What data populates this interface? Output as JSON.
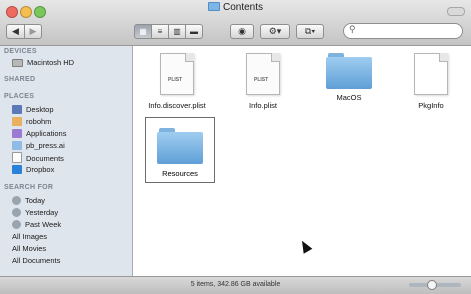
{
  "window": {
    "title": "Contents"
  },
  "toolbar": {
    "back_icon": "chevron-left-icon",
    "forward_icon": "chevron-right-icon",
    "views": [
      "icon-view",
      "list-view",
      "column-view",
      "coverflow-view"
    ],
    "quicklook_icon": "eye-icon",
    "action_icon": "gear-icon",
    "dropbox_icon": "dropbox-icon",
    "search_placeholder": ""
  },
  "sidebar": {
    "devices_header": "DEVICES",
    "devices": [
      {
        "label": "Macintosh HD",
        "icon": "hard-drive-icon"
      }
    ],
    "shared_header": "SHARED",
    "places_header": "PLACES",
    "places": [
      {
        "label": "Desktop",
        "icon": "desktop-icon"
      },
      {
        "label": "robohm",
        "icon": "home-icon"
      },
      {
        "label": "Applications",
        "icon": "applications-icon"
      },
      {
        "label": "pb_press.ai",
        "icon": "folder-icon"
      },
      {
        "label": "Documents",
        "icon": "documents-icon"
      },
      {
        "label": "Dropbox",
        "icon": "dropbox-icon"
      }
    ],
    "search_header": "SEARCH FOR",
    "search": [
      {
        "label": "Today",
        "icon": "clock-icon"
      },
      {
        "label": "Yesterday",
        "icon": "clock-icon"
      },
      {
        "label": "Past Week",
        "icon": "clock-icon"
      },
      {
        "label": "All Images",
        "icon": "smart-folder-icon"
      },
      {
        "label": "All Movies",
        "icon": "smart-folder-icon"
      },
      {
        "label": "All Documents",
        "icon": "smart-folder-icon"
      }
    ]
  },
  "files": [
    {
      "name": "Info.discover.plist",
      "type": "plist",
      "tag": "PLIST"
    },
    {
      "name": "Info.plist",
      "type": "plist",
      "tag": "PLIST"
    },
    {
      "name": "MacOS",
      "type": "folder"
    },
    {
      "name": "PkgInfo",
      "type": "document"
    },
    {
      "name": "Resources",
      "type": "folder",
      "selected": true
    }
  ],
  "status": {
    "text": "5 items, 342.86 GB available"
  }
}
